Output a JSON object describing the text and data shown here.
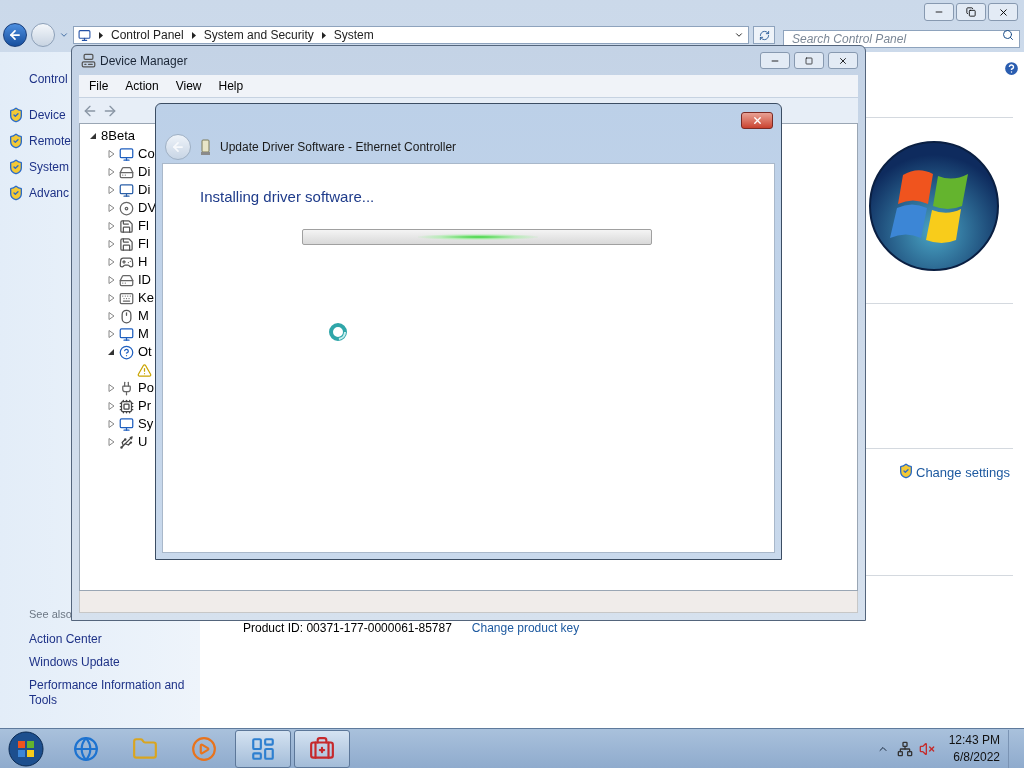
{
  "control_panel": {
    "address": [
      "Control Panel",
      "System and Security",
      "System"
    ],
    "search_placeholder": "Search Control Panel",
    "sidebar": {
      "heading": "Control",
      "items": [
        "Device",
        "Remote",
        "System",
        "Advanc"
      ]
    },
    "see_also": {
      "heading": "See also",
      "items": [
        "Action Center",
        "Windows Update",
        "Performance Information and Tools"
      ]
    },
    "product_id_label": "Product ID:",
    "product_id": "00371-177-0000061-85787",
    "change_product_key": "Change product key",
    "change_settings": "Change settings"
  },
  "device_manager": {
    "title": "Device Manager",
    "menu": [
      "File",
      "Action",
      "View",
      "Help"
    ],
    "tree": {
      "label": "8Beta",
      "expanded": true,
      "children": [
        {
          "label": "Co",
          "kind": "computer",
          "expanded": false
        },
        {
          "label": "Di",
          "kind": "disk",
          "expanded": false
        },
        {
          "label": "Di",
          "kind": "display",
          "expanded": false
        },
        {
          "label": "DV",
          "kind": "dvd",
          "expanded": false
        },
        {
          "label": "Fl",
          "kind": "floppy",
          "expanded": false
        },
        {
          "label": "Fl",
          "kind": "floppy",
          "expanded": false
        },
        {
          "label": "H",
          "kind": "hid",
          "expanded": false
        },
        {
          "label": "ID",
          "kind": "disk",
          "expanded": false
        },
        {
          "label": "Ke",
          "kind": "keyboard",
          "expanded": false
        },
        {
          "label": "M",
          "kind": "mouse",
          "expanded": false
        },
        {
          "label": "M",
          "kind": "computer",
          "expanded": false
        },
        {
          "label": "Ot",
          "kind": "other",
          "expanded": true,
          "children": [
            {
              "kind": "warning"
            }
          ]
        },
        {
          "label": "Po",
          "kind": "port",
          "expanded": false
        },
        {
          "label": "Pr",
          "kind": "chip",
          "expanded": false
        },
        {
          "label": "Sy",
          "kind": "computer",
          "expanded": false
        },
        {
          "label": "U",
          "kind": "usb",
          "expanded": false
        }
      ]
    }
  },
  "dialog": {
    "title": "Update Driver Software - Ethernet Controller",
    "heading": "Installing driver software...",
    "progress": {
      "level": 0.5
    }
  },
  "taskbar": {
    "apps": [
      {
        "kind": "browser",
        "open": false
      },
      {
        "kind": "folder",
        "open": false
      },
      {
        "kind": "media",
        "open": false
      },
      {
        "kind": "control-panel",
        "open": true
      },
      {
        "kind": "toolbox",
        "open": true
      }
    ],
    "time": "12:43 PM",
    "date": "6/8/2022"
  }
}
